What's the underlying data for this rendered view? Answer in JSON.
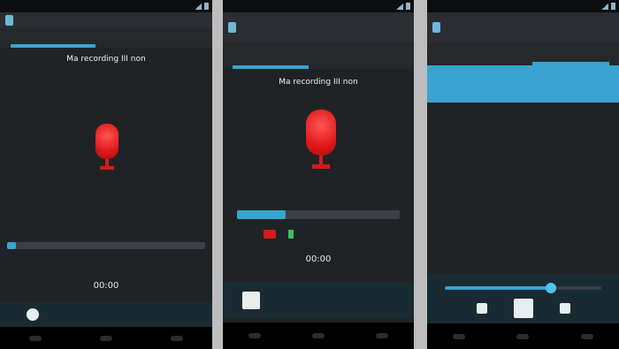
{
  "screens": [
    {
      "status_time": "",
      "title": "",
      "tabs": [
        "",
        ""
      ],
      "heading": "Ma recording III non",
      "progress_label": "",
      "timer": "00:00",
      "left_button": "",
      "right_button": ""
    },
    {
      "status_time": "",
      "title": "",
      "tabs": [
        "",
        ""
      ],
      "heading": "Ma recording III non",
      "progress_label": "",
      "progress_value": 0.3,
      "timer": "00:00",
      "left_button": "",
      "right_button": ""
    },
    {
      "status_time": "",
      "title": "",
      "tabs": [
        "",
        ""
      ],
      "recordings": [
        {
          "name": "",
          "sub": "",
          "duration": ""
        },
        {
          "name": "",
          "sub": "",
          "duration": ""
        },
        {
          "name": "",
          "sub": "",
          "duration": ""
        }
      ],
      "player_progress": 0.68
    }
  ],
  "colors": {
    "accent": "#35a6cf",
    "record_red": "#e01919",
    "background": "#202326"
  }
}
